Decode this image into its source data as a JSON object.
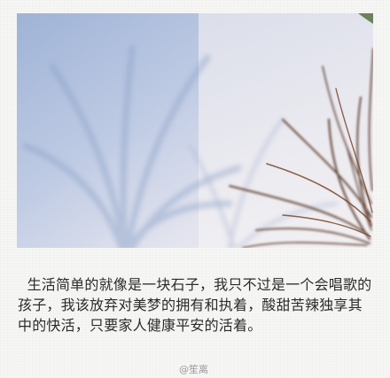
{
  "caption": {
    "text": "  生活简单的就像是一块石子，我只不过是一个会唱歌的孩子，我该放弃对美梦的拥有和执着，酸甜苦辣独享其中的快活，只要家人健康平安的活着。"
  },
  "watermark": {
    "text": "@笙离"
  },
  "colors": {
    "background": "#f6f6f4",
    "sky_blue": "#a9bbda",
    "text": "#2b2b2b",
    "plant": "#5a3a2a"
  }
}
